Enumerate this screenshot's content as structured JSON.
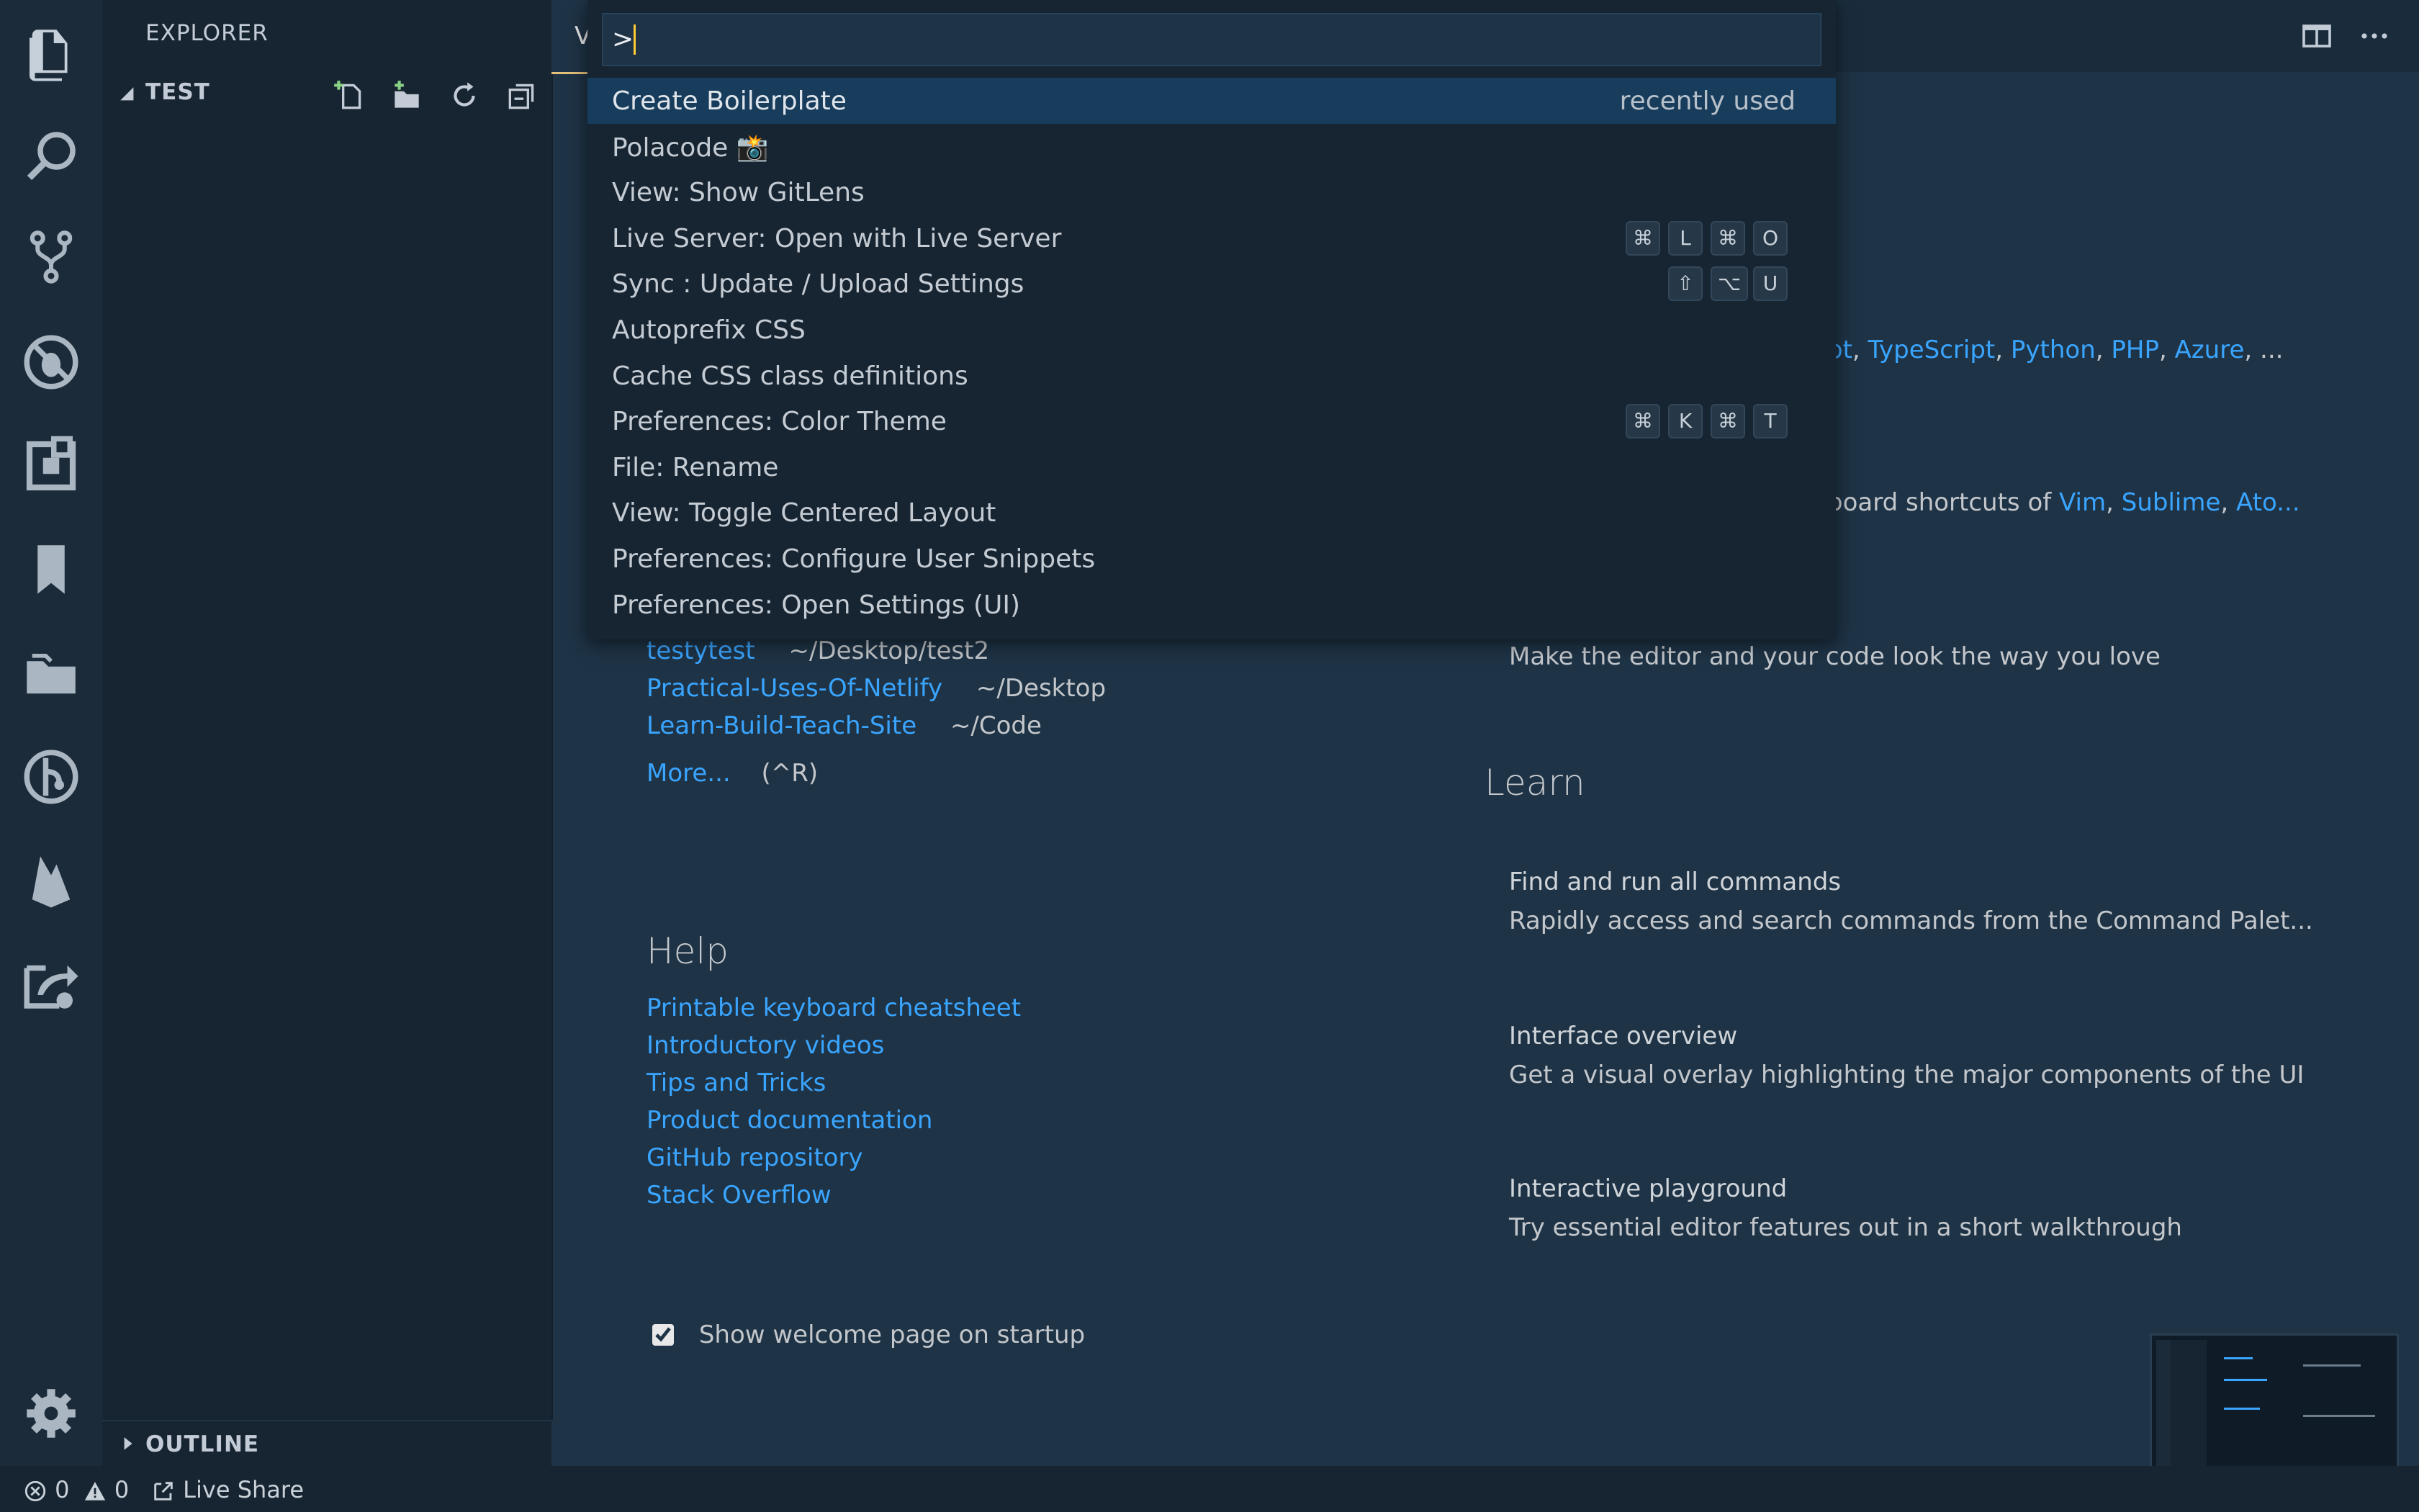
{
  "sidebar": {
    "title": "EXPLORER",
    "folder": "TEST",
    "outline": "OUTLINE"
  },
  "activity_icons": [
    "files-icon",
    "search-icon",
    "source-control-icon",
    "debug-icon",
    "extensions-icon",
    "bookmark-icon",
    "project-manager-icon",
    "gitlens-icon",
    "firebase-icon",
    "live-share-icon",
    "settings-gear-icon"
  ],
  "editor": {
    "tab_label": "V",
    "recent": [
      {
        "name": "testytest",
        "path": "~/Desktop/test2"
      },
      {
        "name": "Practical-Uses-Of-Netlify",
        "path": "~/Desktop"
      },
      {
        "name": "Learn-Build-Teach-Site",
        "path": "~/Code"
      }
    ],
    "more_link": "More...",
    "more_shortcut": "(^R)",
    "help_heading": "Help",
    "help_links": [
      "Printable keyboard cheatsheet",
      "Introductory videos",
      "Tips and Tricks",
      "Product documentation",
      "GitHub repository",
      "Stack Overflow"
    ],
    "show_welcome_label": "Show welcome page on startup",
    "show_welcome_checked": true,
    "languages": {
      "prefix": "pt",
      "items": [
        "TypeScript",
        "Python",
        "PHP",
        "Azure"
      ],
      "ellipsis": "..."
    },
    "keymaps": {
      "prefix": "board shortcuts of",
      "items": [
        "Vim",
        "Sublime"
      ],
      "truncated": "Ato..."
    },
    "theme_desc": "Make the editor and your code look the way you love",
    "learn_heading": "Learn",
    "learn_items": [
      {
        "title": "Find and run all commands",
        "desc": "Rapidly access and search commands from the Command Palet..."
      },
      {
        "title": "Interface overview",
        "desc": "Get a visual overlay highlighting the major components of the UI"
      },
      {
        "title": "Interactive playground",
        "desc": "Try essential editor features out in a short walkthrough"
      }
    ]
  },
  "quickpick": {
    "input_value": ">",
    "items": [
      {
        "label": "Create Boilerplate",
        "right": "recently used",
        "keys": []
      },
      {
        "label": "Polacode 📸",
        "right": "",
        "keys": []
      },
      {
        "label": "View: Show GitLens",
        "right": "",
        "keys": []
      },
      {
        "label": "Live Server: Open with Live Server",
        "right": "",
        "keys": [
          "⌘",
          "L",
          "⌘",
          "O"
        ]
      },
      {
        "label": "Sync : Update / Upload Settings",
        "right": "",
        "keys": [
          "⇧",
          "⌥",
          "U"
        ]
      },
      {
        "label": "Autoprefix CSS",
        "right": "",
        "keys": []
      },
      {
        "label": "Cache CSS class definitions",
        "right": "",
        "keys": []
      },
      {
        "label": "Preferences: Color Theme",
        "right": "",
        "keys": [
          "⌘",
          "K",
          "⌘",
          "T"
        ]
      },
      {
        "label": "File: Rename",
        "right": "",
        "keys": []
      },
      {
        "label": "View: Toggle Centered Layout",
        "right": "",
        "keys": []
      },
      {
        "label": "Preferences: Configure User Snippets",
        "right": "",
        "keys": []
      },
      {
        "label": "Preferences: Open Settings (UI)",
        "right": "",
        "keys": []
      }
    ]
  },
  "statusbar": {
    "errors": "0",
    "warnings": "0",
    "live_share": "Live Share"
  },
  "colors": {
    "accent_link": "#3aa5ff",
    "selection": "#173c5c",
    "caret": "#ffcc33"
  }
}
